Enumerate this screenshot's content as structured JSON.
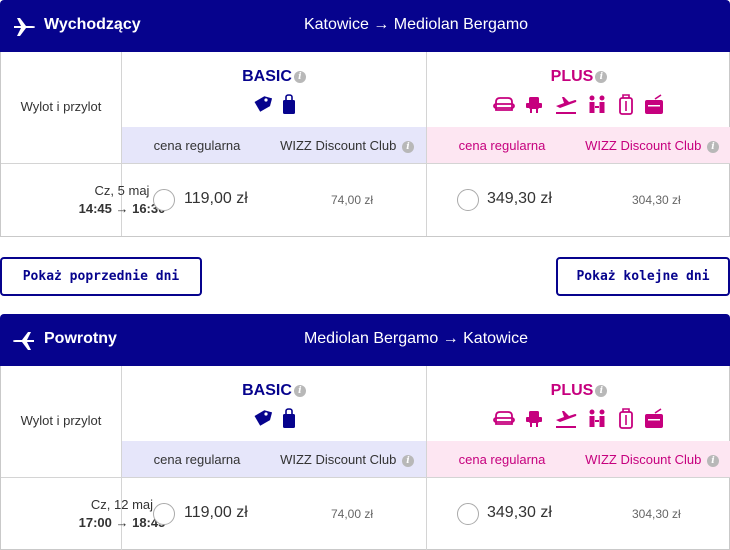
{
  "outbound": {
    "direction_label": "Wychodzący",
    "route": "Katowice → Mediolan Bergamo",
    "left_header": "Wylot i przylot",
    "basic": {
      "title": "BASIC",
      "regular_label": "cena regularna",
      "club_label": "WIZZ Discount Club",
      "icons": [
        "tag-icon",
        "small-bag-icon"
      ]
    },
    "plus": {
      "title": "PLUS",
      "regular_label": "cena regularna",
      "club_label": "WIZZ Discount Club",
      "icons": [
        "seat-icon",
        "priority-boarding-icon",
        "flight-change-icon",
        "check-in-passengers-icon",
        "trolley-bag-icon",
        "checked-bag-icon"
      ]
    },
    "row": {
      "date": "Cz, 5 maj",
      "times": "14:45 → 16:30",
      "basic_price": "119,00 zł",
      "basic_club_price": "74,00 zł",
      "plus_price": "349,30 zł",
      "plus_club_price": "304,30 zł"
    }
  },
  "navigation": {
    "prev_label": "Pokaż poprzednie dni",
    "next_label": "Pokaż kolejne dni"
  },
  "return": {
    "direction_label": "Powrotny",
    "route": "Mediolan Bergamo → Katowice",
    "left_header": "Wylot i przylot",
    "basic": {
      "title": "BASIC",
      "regular_label": "cena regularna",
      "club_label": "WIZZ Discount Club"
    },
    "plus": {
      "title": "PLUS",
      "regular_label": "cena regularna",
      "club_label": "WIZZ Discount Club"
    },
    "row": {
      "date": "Cz, 12 maj",
      "times": "17:00 → 18:45",
      "basic_price": "119,00 zł",
      "basic_club_price": "74,00 zł",
      "plus_price": "349,30 zł",
      "plus_club_price": "304,30 zł"
    }
  },
  "colors": {
    "header_bg": "#06038d",
    "basic": "#06038d",
    "plus": "#c6007e",
    "basic_band": "#e6e6fa",
    "plus_band": "#fde6f2"
  }
}
